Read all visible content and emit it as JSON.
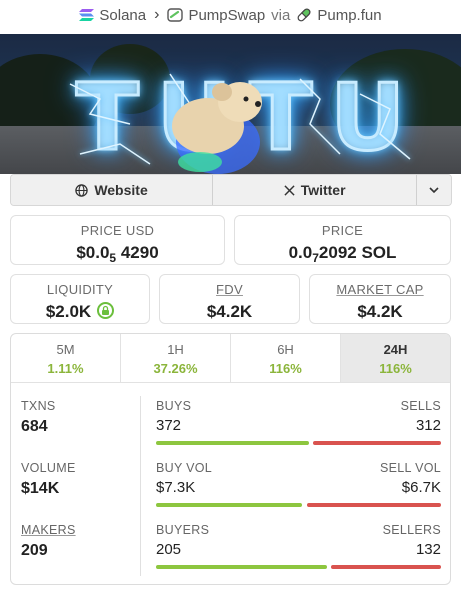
{
  "breadcrumb": {
    "chain": "Solana",
    "dex": "PumpSwap",
    "via_word": "via",
    "source": "Pump.fun"
  },
  "banner": {
    "title_text": "TUTU"
  },
  "links": {
    "website": "Website",
    "twitter": "Twitter"
  },
  "price_usd": {
    "label": "PRICE USD",
    "prefix": "$0.0",
    "zeros": "5",
    "digits": "4290"
  },
  "price_native": {
    "label": "PRICE",
    "prefix": "0.0",
    "zeros": "7",
    "digits": "2092 SOL"
  },
  "liquidity": {
    "label": "LIQUIDITY",
    "value": "$2.0K"
  },
  "fdv": {
    "label": "FDV",
    "value": "$4.2K"
  },
  "market_cap": {
    "label": "MARKET CAP",
    "value": "$4.2K"
  },
  "tabs": [
    {
      "label": "5M",
      "change": "1.11%"
    },
    {
      "label": "1H",
      "change": "37.26%"
    },
    {
      "label": "6H",
      "change": "116%"
    },
    {
      "label": "24H",
      "change": "116%"
    }
  ],
  "stats": {
    "txns": {
      "label": "TXNS",
      "value": "684",
      "left_label": "BUYS",
      "left_value": "372",
      "right_label": "SELLS",
      "right_value": "312",
      "buy_fraction": 0.544
    },
    "volume": {
      "label": "VOLUME",
      "value": "$14K",
      "left_label": "BUY VOL",
      "left_value": "$7.3K",
      "right_label": "SELL VOL",
      "right_value": "$6.7K",
      "buy_fraction": 0.521
    },
    "makers": {
      "label": "MAKERS",
      "value": "209",
      "left_label": "BUYERS",
      "left_value": "205",
      "right_label": "SELLERS",
      "right_value": "132",
      "buy_fraction": 0.608
    }
  },
  "colors": {
    "buy": "#8dc63f",
    "sell": "#d9534f",
    "change": "#8bb53b",
    "lock": "#6bbf3c"
  },
  "icons": {
    "chain": "solana-icon",
    "dex": "pumpswap-icon",
    "source": "pill-icon",
    "website": "globe-icon",
    "twitter": "x-icon",
    "more": "chevron-down-icon",
    "liquidity": "lock-icon"
  }
}
